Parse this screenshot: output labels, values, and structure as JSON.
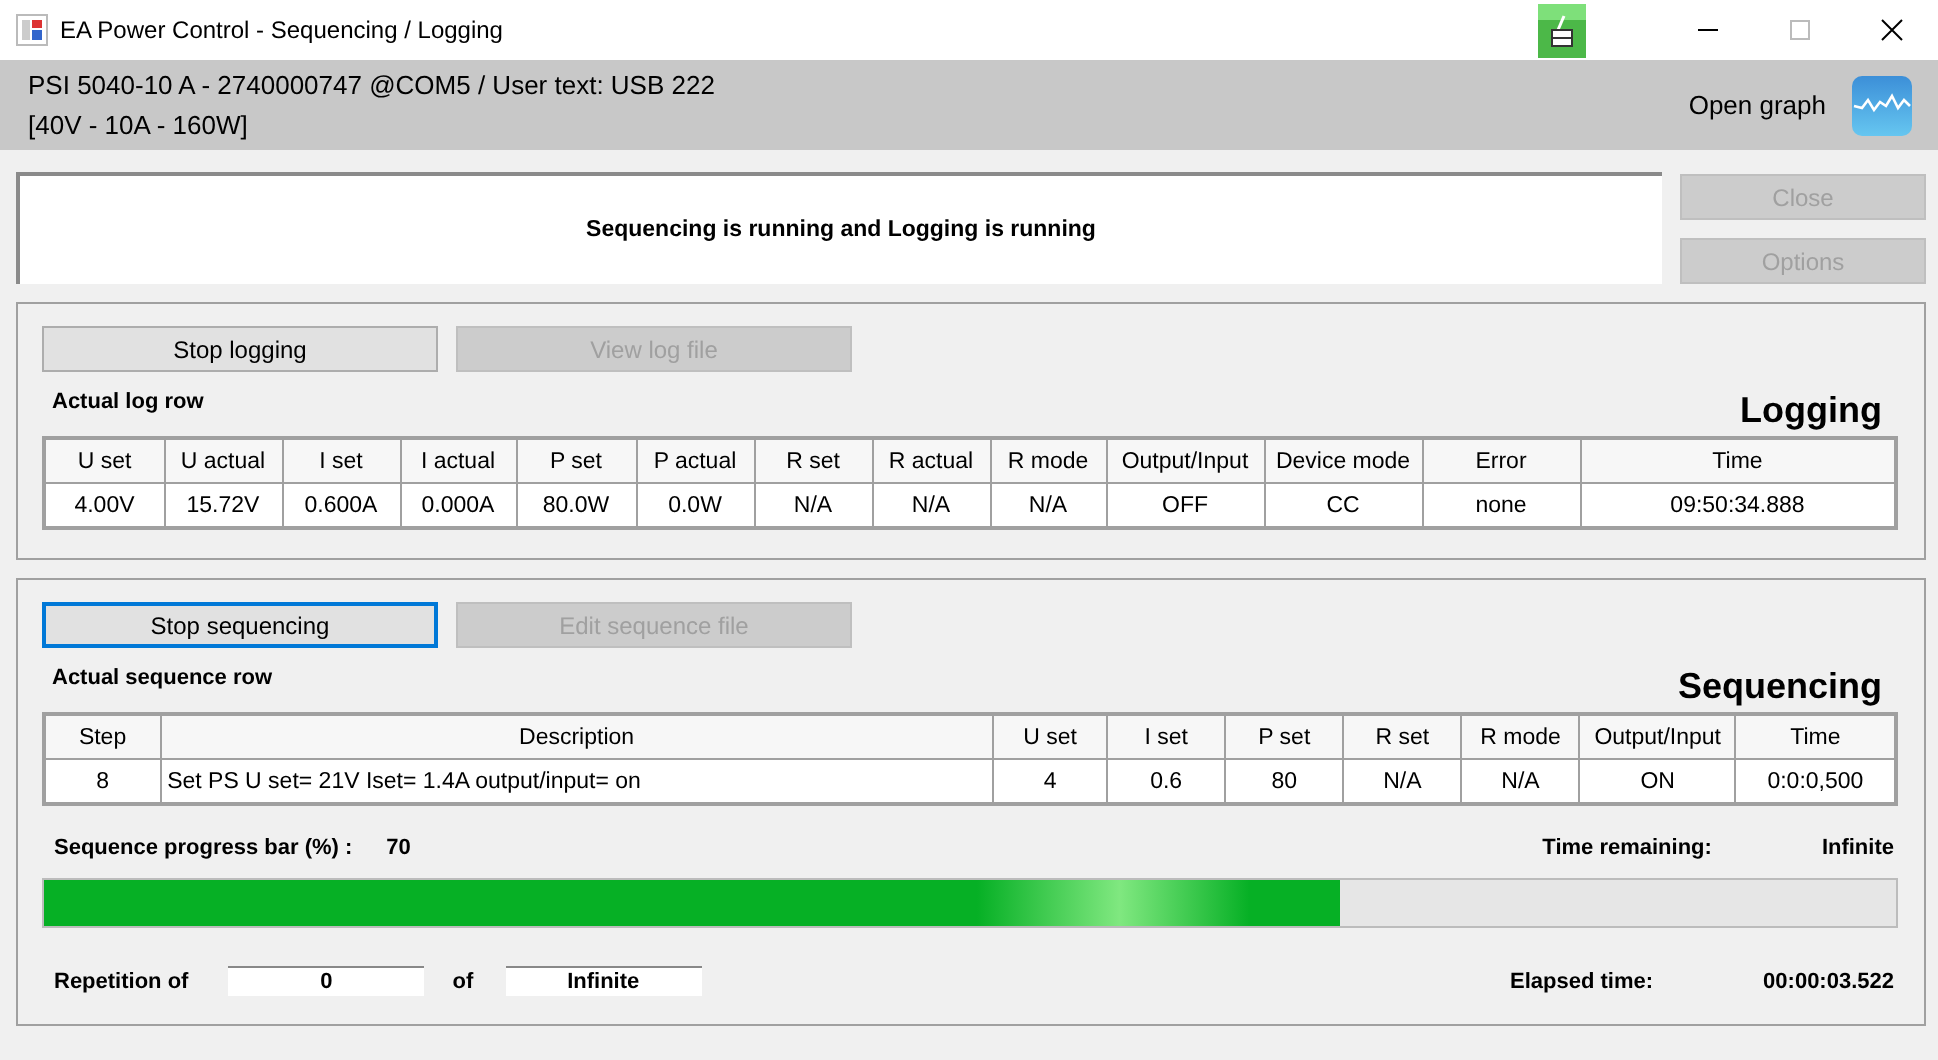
{
  "window": {
    "title": "EA Power Control - Sequencing / Logging"
  },
  "device": {
    "line_1": "PSI 5040-10 A - 2740000747 @COM5 / User text: USB 222",
    "line_2": "[40V - 10A - 160W]",
    "graph_button": "Open graph"
  },
  "status": {
    "message": "Sequencing is running and Logging is running"
  },
  "side_buttons": [
    {
      "label": "Close",
      "disabled": true
    },
    {
      "label": "Options",
      "disabled": true
    }
  ],
  "logging": {
    "title": "Logging",
    "buttons": [
      {
        "label": "Stop logging",
        "disabled": false,
        "focused": false
      },
      {
        "label": "View log file",
        "disabled": true,
        "focused": false
      }
    ],
    "caption": "Actual log row",
    "table": {
      "columns": [
        "U set",
        "U actual",
        "I set",
        "I actual",
        "P set",
        "P actual",
        "R set",
        "R actual",
        "R mode",
        "Output/Input",
        "Device mode",
        "Error",
        "Time"
      ],
      "rows": [
        [
          "4.00V",
          "15.72V",
          "0.600A",
          "0.000A",
          "80.0W",
          "0.0W",
          "N/A",
          "N/A",
          "N/A",
          "OFF",
          "CC",
          "none",
          "09:50:34.888"
        ]
      ]
    }
  },
  "sequencing": {
    "title": "Sequencing",
    "buttons": [
      {
        "label": "Stop sequencing",
        "disabled": false,
        "focused": true
      },
      {
        "label": "Edit sequence file",
        "disabled": true,
        "focused": false
      }
    ],
    "caption": "Actual sequence row",
    "table": {
      "columns": [
        "Step",
        "Description",
        "U set",
        "I set",
        "P set",
        "R set",
        "R mode",
        "Output/Input",
        "Time"
      ],
      "rows": [
        [
          "8",
          "Set PS U set= 21V Iset= 1.4A output/input= on",
          "4",
          "0.6",
          "80",
          "N/A",
          "N/A",
          "ON",
          "0:0:0,500"
        ]
      ]
    },
    "progress": {
      "label": "Sequence progress bar (%) :",
      "value": "70",
      "level": 0.7,
      "remaining_label": "Time remaining:",
      "remaining": "Infinite"
    },
    "repetition": {
      "label": "Repetition of",
      "count": "0",
      "of_label": "of",
      "total": "Infinite",
      "elapsed_label": "Elapsed time:",
      "elapsed": "00:00:03.522"
    }
  }
}
